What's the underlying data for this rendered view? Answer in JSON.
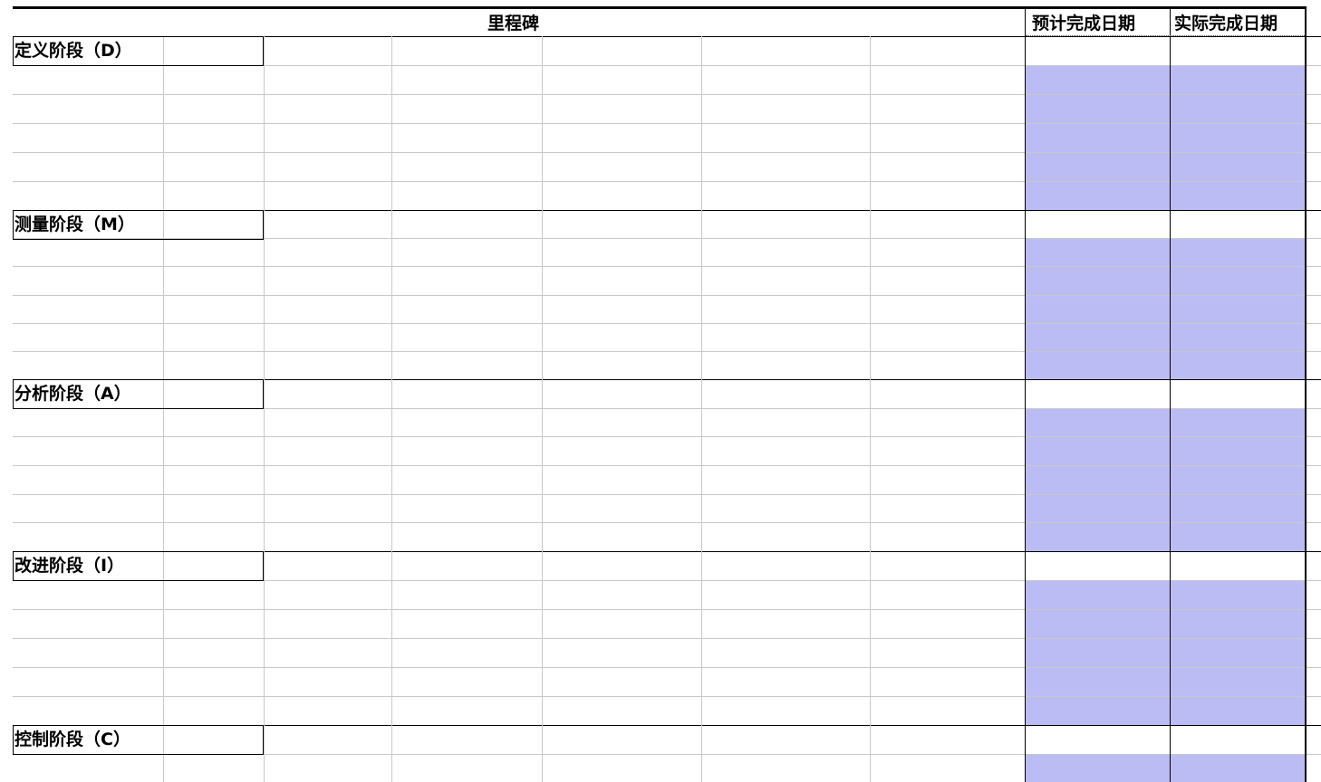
{
  "header": {
    "milestone": "里程碑",
    "planned_date": "预计完成日期",
    "actual_date": "实际完成日期"
  },
  "phases": [
    {
      "label": "定义阶段（D）"
    },
    {
      "label": "测量阶段（M）"
    },
    {
      "label": "分析阶段（A）"
    },
    {
      "label": "改进阶段（I）"
    },
    {
      "label": "控制阶段（C）"
    }
  ],
  "colors": {
    "date_fill": "#bcbcf5",
    "grid": "#c8c8c8",
    "border": "#000000"
  }
}
